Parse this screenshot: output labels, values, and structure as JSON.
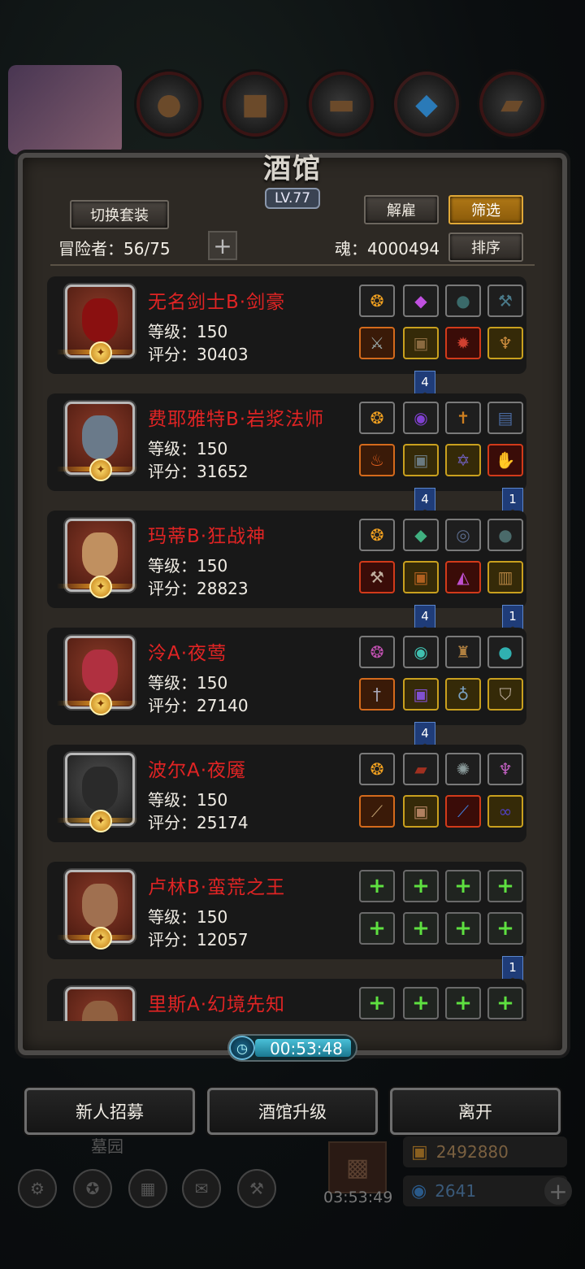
{
  "tavern": {
    "title": "酒馆",
    "level": "LV.77",
    "switch_outfit": "切换套装",
    "dismiss": "解雇",
    "filter": "筛选",
    "sort": "排序",
    "adventurers_label": "冒险者：56/75",
    "soul_label": "魂：4000494"
  },
  "heroes": [
    {
      "name": "无名剑士B·剑豪",
      "level": "等级：150",
      "score": "评分：30403",
      "flag_left": "4",
      "flag_right": ""
    },
    {
      "name": "费耶雅特B·岩浆法师",
      "level": "等级：150",
      "score": "评分：31652",
      "flag_left": "4",
      "flag_right": "1"
    },
    {
      "name": "玛蒂B·狂战神",
      "level": "等级：150",
      "score": "评分：28823",
      "flag_left": "4",
      "flag_right": "1"
    },
    {
      "name": "泠A·夜莺",
      "level": "等级：150",
      "score": "评分：27140",
      "flag_left": "4",
      "flag_right": ""
    },
    {
      "name": "波尔A·夜魇",
      "level": "等级：150",
      "score": "评分：25174",
      "flag_left": "",
      "flag_right": ""
    },
    {
      "name": "卢林B·蛮荒之王",
      "level": "等级：150",
      "score": "评分：12057",
      "flag_left": "",
      "flag_right": "1"
    },
    {
      "name": "里斯A·幻境先知",
      "level": "",
      "score": "",
      "flag_left": "",
      "flag_right": ""
    }
  ],
  "timer": "00:53:48",
  "buttons": {
    "recruit": "新人招募",
    "upgrade": "酒馆升级",
    "leave": "离开"
  },
  "background": {
    "area_name": "墓园",
    "gift_timer": "03:53:49",
    "gold": "2492880",
    "gems": "2641"
  },
  "colors": {
    "hero_name": "#e02424",
    "filter_button": "#b07816",
    "timer_bar": "#4ac0d8",
    "empty_slot_plus": "#5ee040"
  }
}
